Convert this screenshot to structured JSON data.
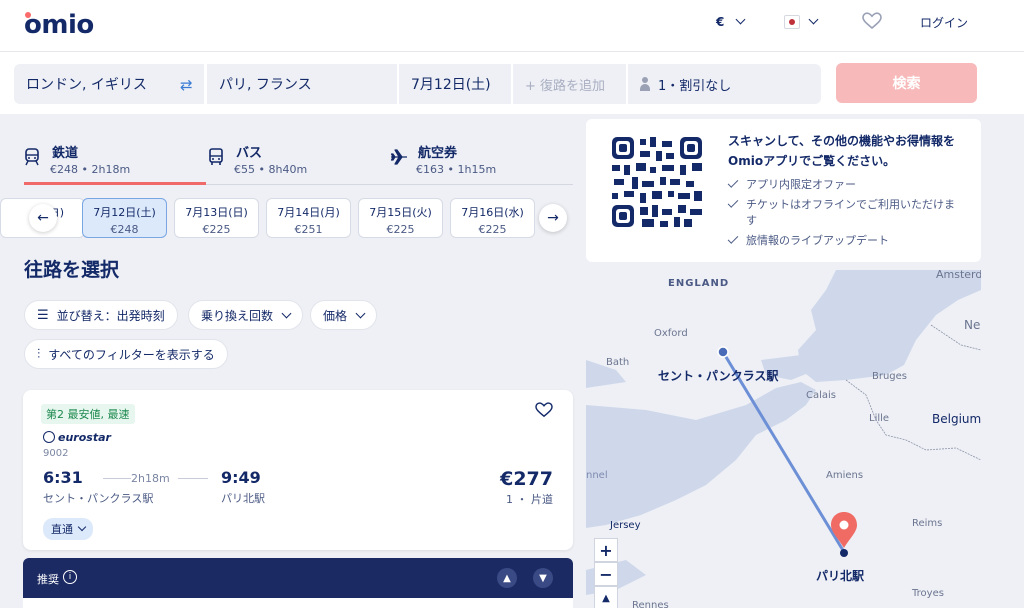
{
  "header": {
    "logo": "omio",
    "currency": "€",
    "login": "ログイン"
  },
  "search": {
    "from": "ロンドン, イギリス",
    "to": "パリ, フランス",
    "date": "7月12日(土)",
    "return_placeholder": "+ 復路を追加",
    "passengers": "1・割引なし",
    "search_button": "検索"
  },
  "tabs": [
    {
      "name": "鉄道",
      "meta": "€248 • 2h18m",
      "icon": "train-icon"
    },
    {
      "name": "バス",
      "meta": "€55 • 8h40m",
      "icon": "bus-icon"
    },
    {
      "name": "航空券",
      "meta": "€163 • 1h15m",
      "icon": "plane-icon"
    }
  ],
  "dates": [
    {
      "label": "7月12日(土)",
      "price": "€248"
    },
    {
      "label": "7月13日(日)",
      "price": "€225"
    },
    {
      "label": "7月14日(月)",
      "price": "€251"
    },
    {
      "label": "7月15日(火)",
      "price": "€225"
    },
    {
      "label": "7月16日(水)",
      "price": "€225"
    }
  ],
  "dates_partial": "ヨ)",
  "heading": "往路を選択",
  "filters": {
    "sort": "並び替え：出発時刻",
    "transfers": "乗り換え回数",
    "price": "価格",
    "all_filters": "すべてのフィルターを表示する"
  },
  "result": {
    "badge": "第2 最安値, 最速",
    "operator": "eurostar",
    "train_number": "9002",
    "dep_time": "6:31",
    "arr_time": "9:49",
    "duration": "2h18m",
    "dep_station": "セント・パンクラス駅",
    "arr_station": "パリ北駅",
    "price": "€277",
    "fare": "1 ・ 片道",
    "direct": "直通"
  },
  "recommend": {
    "label": "推奨",
    "info": "i"
  },
  "qr_panel": {
    "title": "スキャンして、その他の機能やお得情報をOmioアプリでご覧ください。",
    "items": [
      "アプリ内限定オファー",
      "チケットはオフラインでご利用いただけます",
      "旅情報のライブアップデート"
    ]
  },
  "map": {
    "england": "ENGLAND",
    "oxford": "Oxford",
    "bath": "Bath",
    "amsterdam": "Amsterdam",
    "ne": "Ne",
    "bruges": "Bruges",
    "calais": "Calais",
    "lille": "Lille",
    "belgium": "Belgium",
    "amiens": "Amiens",
    "channel": "nnel",
    "jersey": "Jersey",
    "reims": "Reims",
    "troyes": "Troyes",
    "rennes": "Rennes",
    "origin": "セント・パンクラス駅",
    "destination": "パリ北駅",
    "zoom_in": "+",
    "zoom_out": "−"
  },
  "colors": {
    "brand_navy": "#132968",
    "brand_coral": "#fa6b6b",
    "route_blue": "#6c8fd6"
  }
}
